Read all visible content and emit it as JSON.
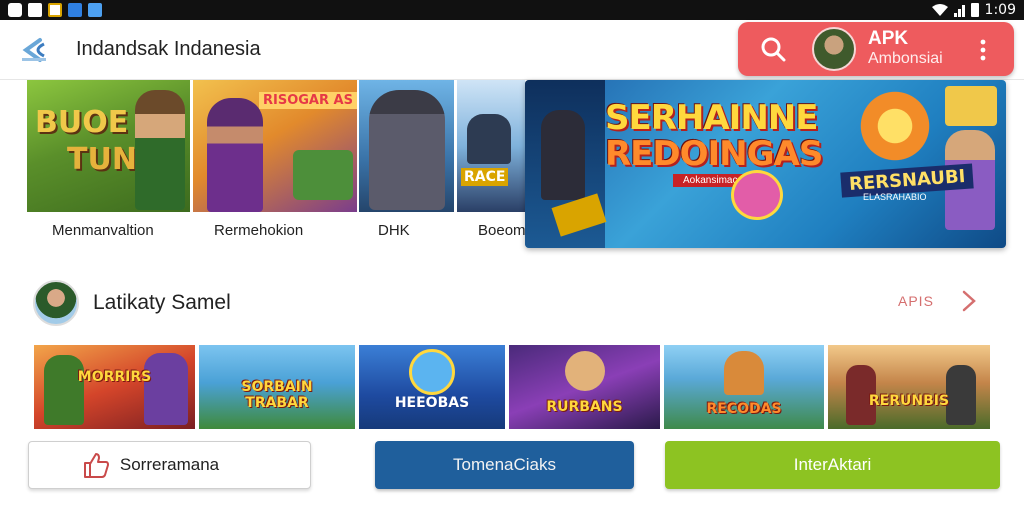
{
  "status_bar": {
    "time": "1:09",
    "icons": [
      "notification-icon",
      "checkbox-icon",
      "mail-icon",
      "app-icon",
      "shield-icon",
      "wifi-icon",
      "signal-icon",
      "battery-icon"
    ]
  },
  "app_bar": {
    "title": "Indandsak Indanesia",
    "logo_icon": "app-logo-icon",
    "search_icon": "search-icon",
    "account": {
      "title": "APK",
      "subtitle": "Ambonsiai"
    },
    "more_icon": "more-vert-icon"
  },
  "carousel": {
    "tiles": [
      {
        "label": "Menmanvaltion",
        "art_text": "BUOE\nTUN"
      },
      {
        "label": "Rermehokion",
        "art_text": "RISOGAR AS"
      },
      {
        "label": "DHK",
        "art_text": ""
      },
      {
        "label": "Boeom",
        "art_text": "RACE"
      }
    ],
    "banner": {
      "title_line1": "SERHAINNE",
      "title_line2": "REDOINGAS",
      "subtitle": "Aokansimacas",
      "side_title": "RERSNAUBI",
      "side_sub": "ELASRAHABIO"
    }
  },
  "section": {
    "title": "Latikaty Samel",
    "more_label": "APIS",
    "chevron_icon": "chevron-right-icon",
    "games": [
      {
        "title": "MORRIRS"
      },
      {
        "title": "SORBAIN\nTRABAR"
      },
      {
        "title": "HEEOBAS"
      },
      {
        "title": "RURBANS"
      },
      {
        "title": "RECODAS"
      },
      {
        "title": "RERUNBIS"
      }
    ]
  },
  "buttons": {
    "left": {
      "label": "Sorreramana",
      "icon": "thumbs-up-icon"
    },
    "middle": {
      "label": "TomenaCiaks"
    },
    "right": {
      "label": "InterAktari"
    }
  },
  "colors": {
    "accent_red": "#ee5b5e",
    "button_blue": "#1f5f9c",
    "button_green": "#8dc322"
  }
}
